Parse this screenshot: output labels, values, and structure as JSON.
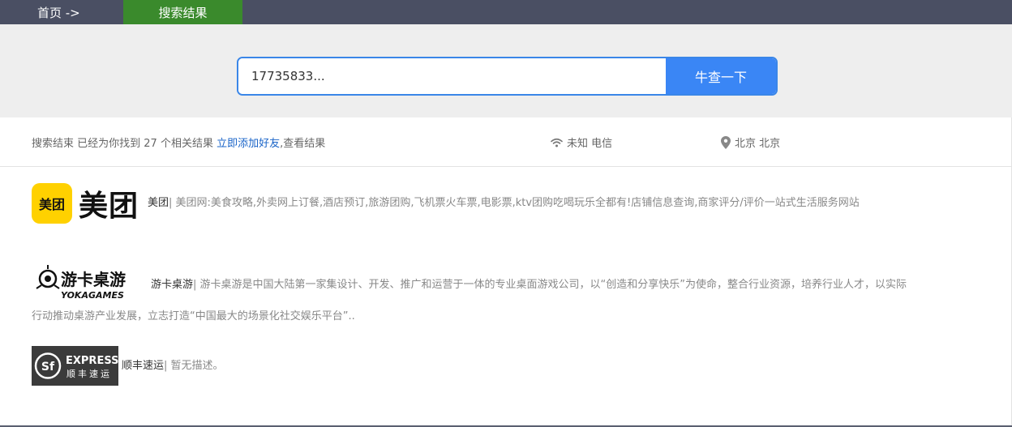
{
  "nav": {
    "home_label": "首页 ->",
    "current_label": "搜索结果"
  },
  "search": {
    "value": "17735833...",
    "button_label": "牛查一下",
    "button_color": "#3a86f5"
  },
  "info": {
    "summary_prefix": "搜索结束 已经为你找到 27 个相关结果",
    "add_friend_link": "立即添加好友",
    "summary_suffix": ",查看结果",
    "network_icon": "wifi-icon",
    "network_text": "未知 电信",
    "location_icon": "map-pin-icon",
    "location_text": "北京 北京"
  },
  "results": [
    {
      "logo_icon": "meituan-logo",
      "logo_square_text": "美团",
      "logo_word": "美团",
      "name": "美团",
      "separator": "|",
      "description": " 美团网:美食攻略,外卖网上订餐,酒店预订,旅游团购,飞机票火车票,电影票,ktv团购吃喝玩乐全都有!店铺信息查询,商家评分/评价一站式生活服务网站"
    },
    {
      "logo_icon": "yokagames-logo",
      "logo_text_cn": "游卡桌游",
      "logo_text_en": "YOKAGAMES",
      "name": "游卡桌游",
      "separator": "|",
      "description_line1": " 游卡桌游是中国大陆第一家集设计、开发、推广和运营于一体的专业桌面游戏公司，以“创造和分享快乐”为使命，整合行业资源，培养行业人才，以实际",
      "description_line2": "行动推动桌游产业发展，立志打造“中国最大的场景化社交娱乐平台”.."
    },
    {
      "logo_icon": "sf-express-logo",
      "logo_text_en": "EXPRESS",
      "logo_text_cn": "顺丰速运",
      "name": "顺丰速运",
      "separator": "|",
      "description": " 暂无描述。"
    }
  ]
}
